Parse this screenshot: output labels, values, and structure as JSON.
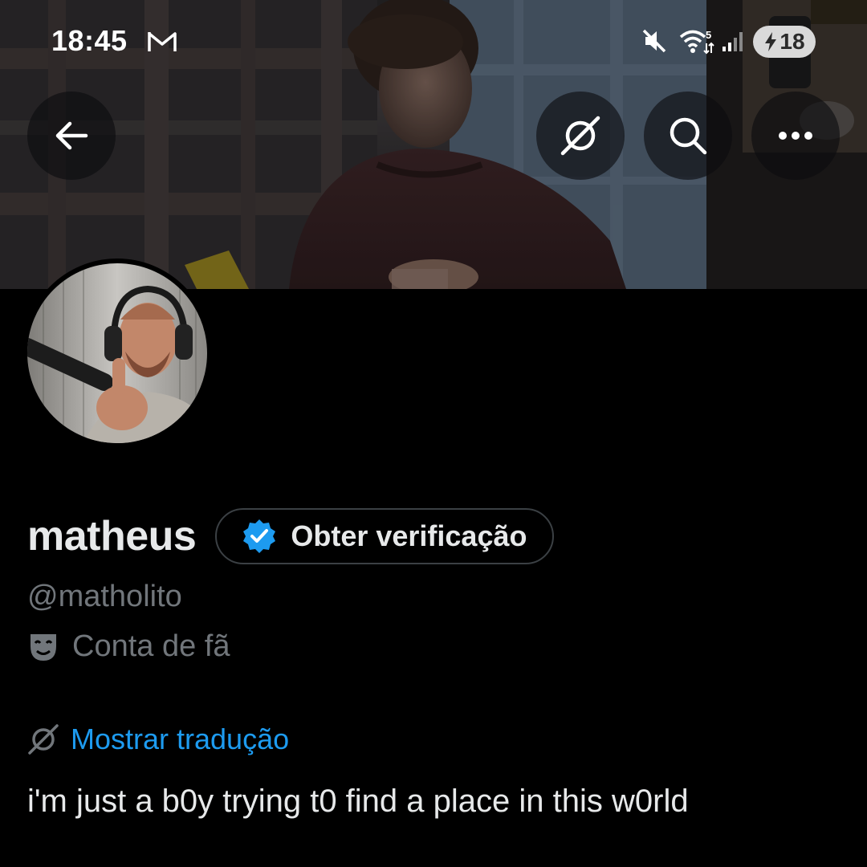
{
  "status_bar": {
    "time": "18:45",
    "battery_level": "18",
    "icons": [
      "gmail-icon",
      "mute-icon",
      "wifi-icon",
      "signal-icon",
      "battery-charging-icon"
    ]
  },
  "header": {
    "buttons": [
      {
        "name": "back-button",
        "icon": "arrow-left-icon"
      },
      {
        "name": "grok-button",
        "icon": "grok-icon"
      },
      {
        "name": "search-button",
        "icon": "search-icon"
      },
      {
        "name": "more-button",
        "icon": "more-horizontal-icon"
      }
    ]
  },
  "profile": {
    "display_name": "matheus",
    "verify_label": "Obter verificação",
    "handle": "@matholito",
    "category": "Conta de fã",
    "category_icon": "theater-mask-icon",
    "translate_label": "Mostrar tradução",
    "translate_icon": "grok-icon",
    "bio": "i'm just a b0y trying t0 find a place in this w0rld"
  },
  "colors": {
    "background": "#000000",
    "text_primary": "#e7e9ea",
    "text_secondary": "#71767b",
    "accent": "#1d9bf0",
    "verify_badge": "#1d9bf0"
  }
}
